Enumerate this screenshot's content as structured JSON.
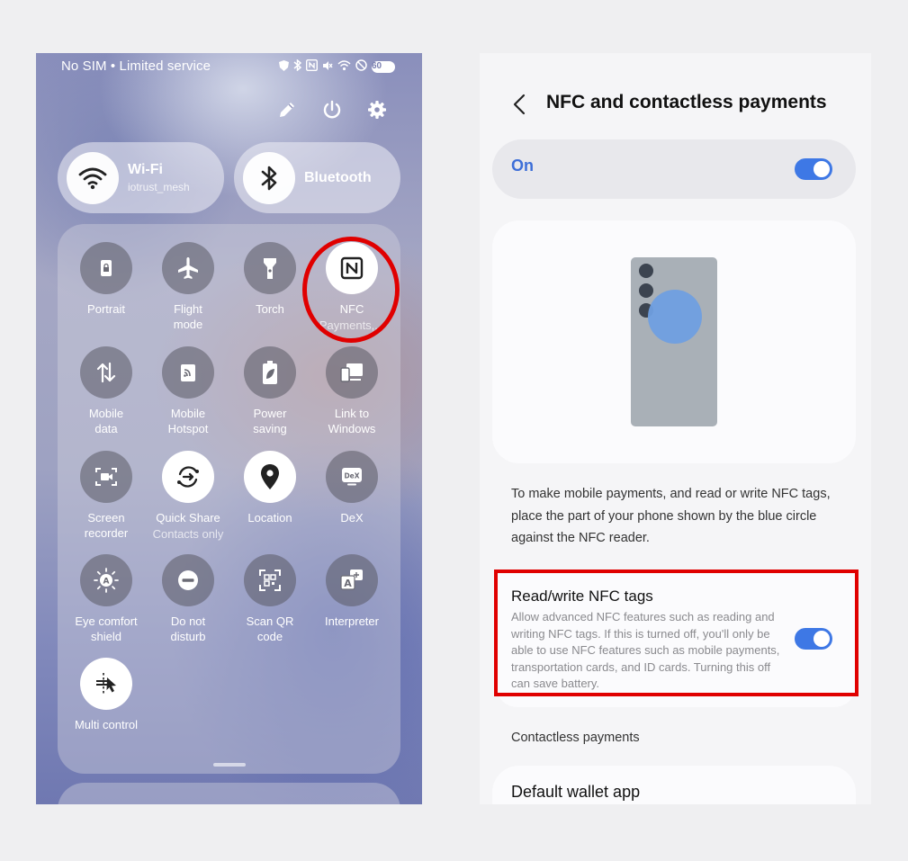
{
  "quick_panel": {
    "status_text": "No SIM • Limited service",
    "battery": "60",
    "wifi": {
      "label": "Wi-Fi",
      "sub": "iotrust_mesh"
    },
    "bluetooth": {
      "label": "Bluetooth"
    },
    "tiles": [
      {
        "label": "Portrait",
        "sub": "",
        "icon": "lock-rotate-icon",
        "on": false
      },
      {
        "label": "Flight\nmode",
        "sub": "",
        "icon": "airplane-icon",
        "on": false
      },
      {
        "label": "Torch",
        "sub": "",
        "icon": "flashlight-icon",
        "on": false
      },
      {
        "label": "NFC",
        "sub": "Payments,...",
        "icon": "nfc-icon",
        "on": true
      },
      {
        "label": "Mobile\ndata",
        "sub": "",
        "icon": "mobile-data-icon",
        "on": false
      },
      {
        "label": "Mobile\nHotspot",
        "sub": "",
        "icon": "hotspot-icon",
        "on": false
      },
      {
        "label": "Power\nsaving",
        "sub": "",
        "icon": "battery-leaf-icon",
        "on": false
      },
      {
        "label": "Link to\nWindows",
        "sub": "",
        "icon": "link-windows-icon",
        "on": false
      },
      {
        "label": "Screen\nrecorder",
        "sub": "",
        "icon": "screen-recorder-icon",
        "on": false
      },
      {
        "label": "Quick Share",
        "sub": "Contacts only",
        "icon": "quick-share-icon",
        "on": true
      },
      {
        "label": "Location",
        "sub": "",
        "icon": "location-pin-icon",
        "on": true
      },
      {
        "label": "DeX",
        "sub": "",
        "icon": "dex-icon",
        "on": false
      },
      {
        "label": "Eye comfort\nshield",
        "sub": "",
        "icon": "eye-comfort-icon",
        "on": false
      },
      {
        "label": "Do not\ndisturb",
        "sub": "",
        "icon": "do-not-disturb-icon",
        "on": false
      },
      {
        "label": "Scan QR\ncode",
        "sub": "",
        "icon": "qr-scan-icon",
        "on": false
      },
      {
        "label": "Interpreter",
        "sub": "",
        "icon": "interpreter-icon",
        "on": false
      },
      {
        "label": "Multi control",
        "sub": "",
        "icon": "multi-control-icon",
        "on": true
      }
    ]
  },
  "settings": {
    "title": "NFC and contactless payments",
    "on_label": "On",
    "description": "To make mobile payments, and read or write NFC tags, place the part of your phone shown by the blue circle against the NFC reader.",
    "rw_title": "Read/write NFC tags",
    "rw_desc": "Allow advanced NFC features such as reading and writing NFC tags. If this is turned off, you'll only be able to use NFC features such as mobile payments, transportation cards, and ID cards. Turning this off can save battery.",
    "section_label": "Contactless payments",
    "wallet_label": "Default wallet app"
  },
  "colors": {
    "accent": "#3e78e5",
    "highlight": "#e00000"
  }
}
